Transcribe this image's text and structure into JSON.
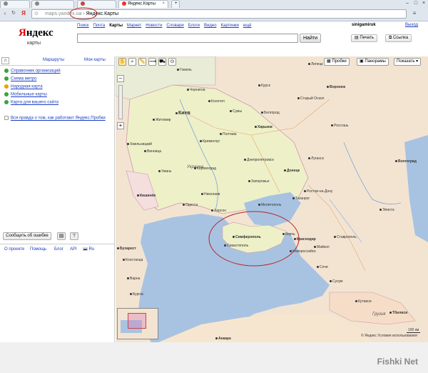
{
  "browser": {
    "tab_active": "Яндекс.Карты",
    "address_host": "maps.yandex.ua",
    "address_title": "Яндекс.Карты",
    "back_icon": "back-arrow-icon",
    "menu_icon": "menu-icon"
  },
  "header": {
    "logo_word": "Яндекс",
    "logo_sub": "карты",
    "services": [
      "Поиск",
      "Почта",
      "Карты",
      "Маркет",
      "Новости",
      "Словари",
      "Блоги",
      "Видео",
      "Картинки",
      "ещё"
    ],
    "active_service": "Карты",
    "user": "sinigamiruk",
    "logout": "Выход",
    "find_button": "Найти",
    "print_button": "Печать",
    "link_button": "Ссылка"
  },
  "sidebar": {
    "tabs": [
      "Маршруты",
      "Мои карты"
    ],
    "links": [
      "Справочник организаций",
      "Схема метро",
      "Народная карта",
      "Мобильные карты",
      "Карта для вашего сайта"
    ],
    "promo": "Вся правда о том, как работают Яндекс.Пробки",
    "report_button": "Сообщить об ошибке",
    "footer": [
      "О проекте",
      "Помощь",
      "Блог",
      "API",
      "Ru"
    ]
  },
  "map": {
    "buttons": [
      "Пробки",
      "Панорамы",
      "Показать ▾"
    ],
    "country_labels": [
      "Украина",
      "Грузия"
    ],
    "cities": [
      "Гомель",
      "Чернигов",
      "Конотоп",
      "Сумы",
      "Курск",
      "Белгород",
      "Старый Оскол",
      "Киев",
      "Житомир",
      "Хмельницкий",
      "Винница",
      "Полтава",
      "Харьков",
      "Кременчуг",
      "Днепропетровск",
      "Донецк",
      "Луганск",
      "Запорожье",
      "Кировоград",
      "Умань",
      "Кишинёв",
      "Николаев",
      "Одесса",
      "Херсон",
      "Мелитополь",
      "Ростов-на-Дону",
      "Таганрог",
      "Симферополь",
      "Севастополь",
      "Керчь",
      "Краснодар",
      "Новороссийск",
      "Ставрополь",
      "Майкоп",
      "Сочи",
      "Сухум",
      "Элиста",
      "Констанца",
      "Варна",
      "Бургас",
      "Бухарест",
      "Анкара",
      "Тбилиси",
      "Кутаиси",
      "Липецк",
      "Воронеж",
      "Россошь",
      "Волгоград"
    ],
    "copyright": "© Яндекс  Условия использования",
    "scale": "100 км"
  },
  "watermark": "Fishki Net",
  "colors": {
    "accent": "#1a3dc1",
    "sea": "#a8c3e2",
    "land": "#f3e4d2",
    "ukraine": "#eef0c8",
    "yandex_red": "#e00000"
  }
}
